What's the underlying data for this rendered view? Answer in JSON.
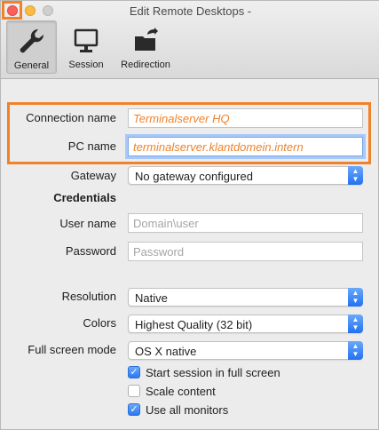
{
  "window": {
    "title": "Edit Remote Desktops -"
  },
  "toolbar": {
    "tabs": [
      {
        "label": "General",
        "icon": "wrench-icon",
        "active": true
      },
      {
        "label": "Session",
        "icon": "monitor-icon",
        "active": false
      },
      {
        "label": "Redirection",
        "icon": "folder-redirect-icon",
        "active": false
      }
    ]
  },
  "form": {
    "connection_name": {
      "label": "Connection name",
      "value": "Terminalserver HQ"
    },
    "pc_name": {
      "label": "PC name",
      "value": "terminalserver.klantdomein.intern"
    },
    "gateway": {
      "label": "Gateway",
      "value": "No gateway configured"
    },
    "credentials_heading": "Credentials",
    "user_name": {
      "label": "User name",
      "placeholder": "Domain\\user"
    },
    "password": {
      "label": "Password",
      "placeholder": "Password"
    },
    "resolution": {
      "label": "Resolution",
      "value": "Native"
    },
    "colors": {
      "label": "Colors",
      "value": "Highest Quality (32 bit)"
    },
    "full_screen_mode": {
      "label": "Full screen mode",
      "value": "OS X native"
    },
    "options": [
      {
        "label": "Start session in full screen",
        "checked": true
      },
      {
        "label": "Scale content",
        "checked": false
      },
      {
        "label": "Use all monitors",
        "checked": true
      }
    ]
  },
  "colors": {
    "highlight": "#f0822a",
    "accent": "#2b78f2"
  }
}
